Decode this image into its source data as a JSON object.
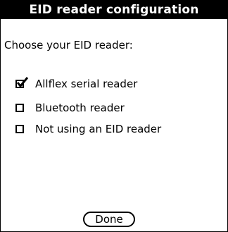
{
  "dialog": {
    "title": "EID reader configuration",
    "prompt": "Choose your EID reader:"
  },
  "options": [
    {
      "label": "Allflex serial reader",
      "checked": true
    },
    {
      "label": "Bluetooth reader",
      "checked": false
    },
    {
      "label": "Not using an  EID reader",
      "checked": false
    }
  ],
  "buttons": {
    "done_label": "Done"
  },
  "colors": {
    "title_background": "#000000",
    "title_text": "#ffffff",
    "background": "#ffffff",
    "foreground": "#000000"
  },
  "icons": {
    "checked_box": "checkbox-checked-icon",
    "unchecked_box": "checkbox-unchecked-icon"
  }
}
